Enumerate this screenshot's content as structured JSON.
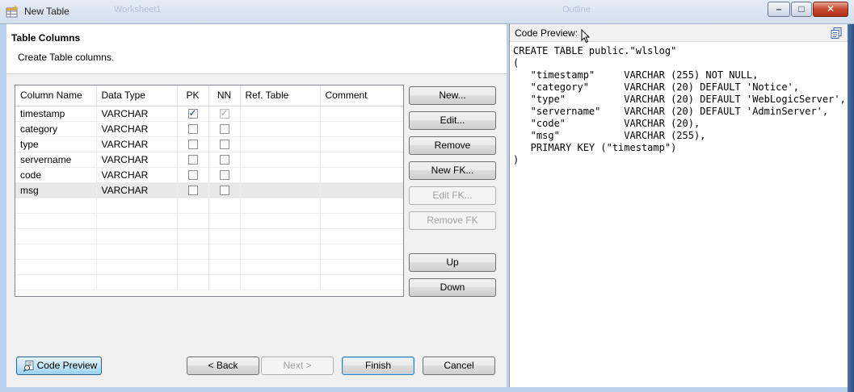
{
  "window": {
    "title": "New Table",
    "ghost_tabs": [
      "Worksheet1",
      "Outline"
    ],
    "minimize": "–",
    "maximize": "□",
    "close": "✕"
  },
  "page": {
    "header_title": "Table Columns",
    "header_description": "Create Table columns."
  },
  "table": {
    "columns": [
      "Column Name",
      "Data Type",
      "PK",
      "NN",
      "Ref. Table",
      "Comment"
    ],
    "rows": [
      {
        "name": "timestamp",
        "type": "VARCHAR",
        "pk": true,
        "nn": true,
        "ref": "",
        "comment": ""
      },
      {
        "name": "category",
        "type": "VARCHAR",
        "pk": false,
        "nn": false,
        "ref": "",
        "comment": ""
      },
      {
        "name": "type",
        "type": "VARCHAR",
        "pk": false,
        "nn": false,
        "ref": "",
        "comment": ""
      },
      {
        "name": "servername",
        "type": "VARCHAR",
        "pk": false,
        "nn": false,
        "ref": "",
        "comment": ""
      },
      {
        "name": "code",
        "type": "VARCHAR",
        "pk": false,
        "nn": false,
        "ref": "",
        "comment": ""
      },
      {
        "name": "msg",
        "type": "VARCHAR",
        "pk": false,
        "nn": false,
        "ref": "",
        "comment": ""
      }
    ],
    "selected_row": 5
  },
  "side_buttons": {
    "new": "New...",
    "edit": "Edit...",
    "remove": "Remove",
    "new_fk": "New FK...",
    "edit_fk": "Edit FK...",
    "remove_fk": "Remove FK",
    "up": "Up",
    "down": "Down"
  },
  "bottom_buttons": {
    "code_preview": "Code Preview",
    "back": "< Back",
    "next": "Next >",
    "finish": "Finish",
    "cancel": "Cancel"
  },
  "preview": {
    "title": "Code Preview:",
    "code": "CREATE TABLE public.\"wlslog\"\n(\n   \"timestamp\"     VARCHAR (255) NOT NULL,\n   \"category\"      VARCHAR (20) DEFAULT 'Notice',\n   \"type\"          VARCHAR (20) DEFAULT 'WebLogicServer',\n   \"servername\"    VARCHAR (20) DEFAULT 'AdminServer',\n   \"code\"          VARCHAR (20),\n   \"msg\"           VARCHAR (255),\n   PRIMARY KEY (\"timestamp\")\n)"
  }
}
